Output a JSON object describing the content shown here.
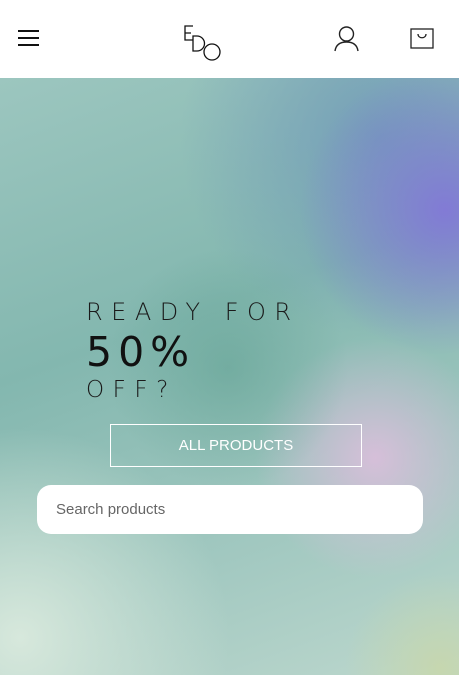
{
  "header": {
    "menu_icon": "hamburger-menu-icon",
    "logo_letters": "EDO",
    "account_icon": "user-icon",
    "cart_icon": "shopping-bag-icon"
  },
  "hero": {
    "line1": "READY FOR",
    "discount": "50%",
    "line3": "OFF?",
    "button_label": "ALL PRODUCTS",
    "search_placeholder": "Search products"
  },
  "colors": {
    "button_border": "#ffffff",
    "text_dark": "#111111",
    "accent_purple": "#8278d7",
    "accent_teal": "#83b7af"
  }
}
